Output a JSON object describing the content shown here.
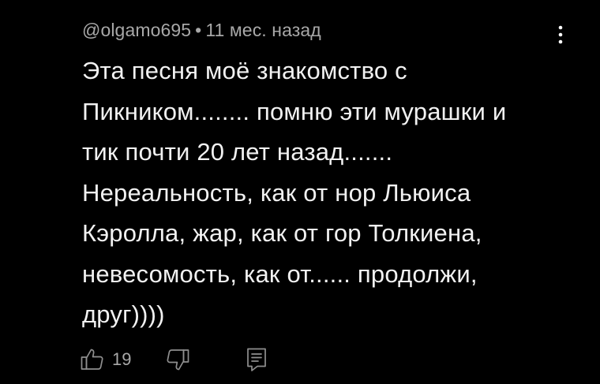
{
  "comment": {
    "author": "@olgamo695",
    "separator": "•",
    "time": "11 мес. назад",
    "lines": [
      "Эта песня моё знакомство с",
      "Пикником........ помню эти мурашки и",
      "тик почти 20 лет назад.......",
      "Нереальность, как от нор Льюиса",
      "Кэролла, жар, как от гор Толкиена,",
      "невесомость, как от...... продолжи,",
      "друг))))"
    ],
    "like_count": "19"
  },
  "icons": {
    "menu": "more-vertical-icon",
    "like": "thumbs-up-icon",
    "dislike": "thumbs-down-icon",
    "reply": "reply-comment-icon"
  },
  "colors": {
    "background": "#000000",
    "text": "#f1f1f1",
    "secondary_text": "#a8a8a8",
    "icon": "#8f8f8f"
  }
}
